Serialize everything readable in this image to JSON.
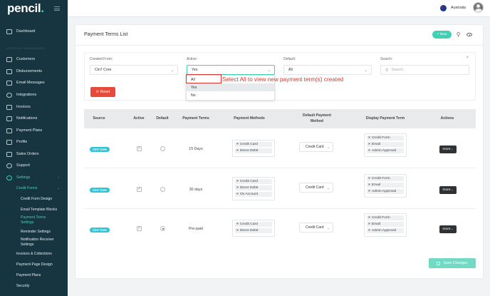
{
  "brand": {
    "logo": "pencil",
    "logo_dot": "."
  },
  "topbar": {
    "country": "Australia",
    "flag_icon": "australia-flag-icon"
  },
  "sidebar": {
    "section_label": "SUPPLIER MANAGEMENT",
    "items": [
      {
        "label": "Dashboard",
        "icon": "dashboard-icon"
      },
      {
        "label": "Customers",
        "icon": "customers-icon"
      },
      {
        "label": "Disbursements",
        "icon": "disbursements-icon"
      },
      {
        "label": "Email Messages",
        "icon": "email-icon"
      },
      {
        "label": "Integrations",
        "icon": "integrations-icon"
      },
      {
        "label": "Invoices",
        "icon": "invoices-icon"
      },
      {
        "label": "Notifications",
        "icon": "notifications-icon"
      },
      {
        "label": "Payment Plans",
        "icon": "payment-plans-icon"
      },
      {
        "label": "Profile",
        "icon": "profile-icon"
      },
      {
        "label": "Sales Orders",
        "icon": "sales-orders-icon"
      },
      {
        "label": "Support",
        "icon": "support-icon"
      },
      {
        "label": "Settings",
        "icon": "settings-icon"
      }
    ],
    "settings_sub": {
      "credit_forms": "Credit Forms",
      "children": [
        "Credit Form Design",
        "Email Template Blocks",
        "Payment Terms",
        "Settings",
        "Reminder Settings",
        "Notification Receiver",
        "Settings"
      ],
      "after": [
        "Invoices & Collections",
        "Payment Page Design",
        "Payment Plans",
        "Security"
      ]
    }
  },
  "page": {
    "title": "Payment Terms List",
    "new_button": "New",
    "filters": {
      "created_from_label": "Created From:",
      "created_from_value": "Cin7 Core",
      "active_label": "Active:",
      "active_value": "Yes",
      "default_label": "Default:",
      "default_value": "All",
      "search_label": "Search:",
      "search_placeholder": "Search..."
    },
    "reset_button": "Reset",
    "active_dropdown": {
      "options": [
        "All",
        "Yes",
        "No"
      ]
    },
    "annotation": "Select All to view new payment term(s) created"
  },
  "table": {
    "headers": [
      "Source",
      "Active",
      "Default",
      "Payment Terms",
      "Payment Methods",
      "Default Payment",
      "Method",
      "Display Payment Term",
      "Actions"
    ],
    "rows": [
      {
        "source": "Cin7 Core",
        "active": "✓",
        "default": false,
        "term": "15 Days",
        "methods": [
          "Credit Card",
          "Direct Debit"
        ],
        "default_method": "Credit Card",
        "display": [
          "Credit Form",
          "Email",
          "Admin Approval"
        ],
        "action": "more..."
      },
      {
        "source": "Cin7 Core",
        "active": "✓",
        "default": false,
        "term": "30 days",
        "methods": [
          "Credit Card",
          "Direct Debit",
          "On Account"
        ],
        "default_method": "Credit Card",
        "display": [
          "Credit Form",
          "Email",
          "Admin Approval"
        ],
        "action": "more..."
      },
      {
        "source": "Cin7 Core",
        "active": "✓",
        "default": true,
        "term": "Pre-paid",
        "methods": [
          "Credit Card",
          "Direct Debit"
        ],
        "default_method": "Credit Card",
        "display": [
          "Credit Form",
          "Email",
          "Admin Approval"
        ],
        "action": "more..."
      }
    ]
  },
  "save_button": "Save Changes",
  "colors": {
    "accent": "#3fd1b6",
    "sidebar": "#173541",
    "danger": "#e64a3b",
    "badge": "#2ec4d6"
  }
}
